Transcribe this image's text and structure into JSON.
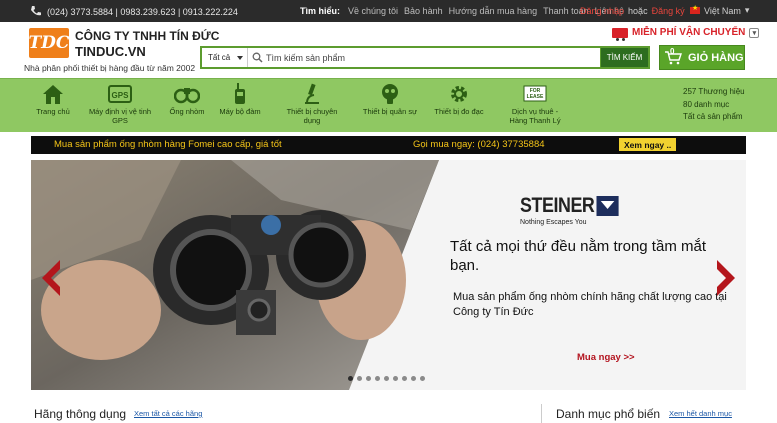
{
  "topbar": {
    "phones": "(024) 3773.5884 | 0983.239.623 | 0913.222.224",
    "links_label": "Tìm hiểu:",
    "links": [
      "Về chúng tôi",
      "Bảo hành",
      "Hướng dẫn mua hàng",
      "Thanh toán",
      "Liên hệ"
    ],
    "login": "Đăng nhập",
    "or": "hoặc",
    "register": "Đăng ký",
    "language": "Việt Nam"
  },
  "header": {
    "logo_text": "TDC",
    "company": "CÔNG TY TNHH TÍN ĐỨC",
    "site": "TINDUC.VN",
    "tagline": "Nhà phân phối thiết bị hàng đầu từ năm 2002",
    "free_shipping": "MIỄN PHÍ VẬN CHUYỂN",
    "search_category": "Tất cả",
    "search_placeholder": "Tìm kiếm sản phẩm",
    "search_button": "TÌM KIẾM",
    "cart_count": "0",
    "cart_label": "GIỎ HÀNG"
  },
  "nav": {
    "items": [
      {
        "label": "Trang chủ",
        "icon": "home-icon"
      },
      {
        "label": "Máy định vị vệ tinh GPS",
        "icon": "gps-icon"
      },
      {
        "label": "Ống nhòm",
        "icon": "binoculars-icon"
      },
      {
        "label": "Máy bộ đàm",
        "icon": "radio-icon"
      },
      {
        "label": "Thiết bị chuyên dụng",
        "icon": "microscope-icon"
      },
      {
        "label": "Thiết bị quân sự",
        "icon": "gas-mask-icon"
      },
      {
        "label": "Thiết bị đo đạc",
        "icon": "gear-icon"
      },
      {
        "label": "Dịch vụ thuê - Hàng Thanh Lý",
        "icon": "for-lease-icon"
      }
    ],
    "stats": [
      "257 Thương hiệu",
      "80 danh mục",
      "Tất cả sản phẩm"
    ]
  },
  "promo": {
    "text": "Mua sản phẩm ống nhòm hàng Fomei cao cấp, giá tốt",
    "call": "Gọi mua ngay: (024) 37735884",
    "button": "Xem ngay .."
  },
  "banner": {
    "brand": "STEINER",
    "slogan": "Nothing Escapes You",
    "headline": "Tất cả mọi thứ đều nằm trong tầm mắt bạn.",
    "sub": "Mua sản phẩm ống nhòm chính hãng chất lượng cao tại Công ty Tín Đức",
    "cta": "Mua ngay >>",
    "slides": 9,
    "active_slide": 1
  },
  "bottom": {
    "brands_title": "Hãng thông dụng",
    "brands_link": "Xem tất cả các hãng",
    "categories_title": "Danh mục phổ biến",
    "categories_link": "Xem hết danh mục"
  }
}
